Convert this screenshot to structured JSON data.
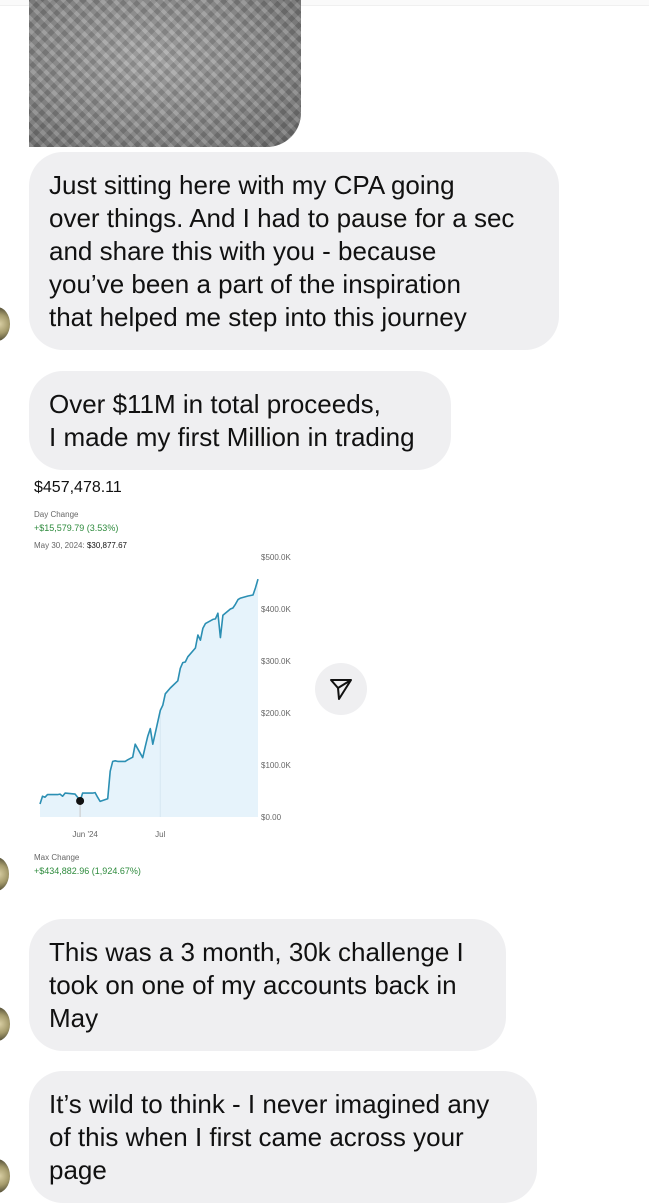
{
  "messages": [
    {
      "lines": [
        "Just sitting here with my CPA going",
        "over things. And I had to pause for a sec",
        "and share this with you - because",
        "you’ve been a part of the inspiration",
        "that helped me step into this journey"
      ]
    },
    {
      "lines": [
        "Over $11M in total proceeds,",
        "I made my first Million in trading"
      ]
    },
    {
      "lines": [
        "This was a 3 month, 30k challenge I",
        "took on one of my accounts back in",
        "May"
      ]
    },
    {
      "lines": [
        "It’s wild to think - I never imagined any",
        "of this when I first came across your",
        "page"
      ]
    }
  ],
  "portfolio": {
    "balance": "$457,478.11",
    "day_change_label": "Day Change",
    "day_change_value": "+$15,579.79 (3.53%)",
    "selected_date": "May 30, 2024:",
    "selected_value": "$30,877.67",
    "max_change_label": "Max Change",
    "max_change_value": "+$434,882.96 (1,924.67%)"
  },
  "chart_data": {
    "type": "area",
    "title": "",
    "xlabel": "",
    "ylabel": "",
    "x_tick_labels": [
      "Jun '24",
      "Jul"
    ],
    "y_tick_labels": [
      "$500.0K",
      "$400.0K",
      "$300.0K",
      "$200.0K",
      "$100.0K",
      "$0.00"
    ],
    "ylim": [
      0,
      500000
    ],
    "y_axis_position": "right",
    "grid": false,
    "line_color": "#2b8fb3",
    "fill_color": "#e6f3fb",
    "marker": {
      "date": "2024-05-30",
      "value": 30877.67,
      "color": "#111111"
    },
    "series": [
      {
        "x": [
          "2024-05-14",
          "2024-05-15",
          "2024-05-16",
          "2024-05-17",
          "2024-05-20",
          "2024-05-21",
          "2024-05-22",
          "2024-05-23",
          "2024-05-24",
          "2024-05-28",
          "2024-05-29",
          "2024-05-30",
          "2024-05-31",
          "2024-06-03",
          "2024-06-04",
          "2024-06-05",
          "2024-06-06",
          "2024-06-07",
          "2024-06-10",
          "2024-06-11",
          "2024-06-12",
          "2024-06-13",
          "2024-06-14",
          "2024-06-17",
          "2024-06-18",
          "2024-06-20",
          "2024-06-21",
          "2024-06-24",
          "2024-06-25",
          "2024-06-26",
          "2024-06-27",
          "2024-06-28",
          "2024-07-01",
          "2024-07-02",
          "2024-07-03",
          "2024-07-05",
          "2024-07-08",
          "2024-07-09",
          "2024-07-10",
          "2024-07-11",
          "2024-07-12",
          "2024-07-15",
          "2024-07-16",
          "2024-07-17",
          "2024-07-18",
          "2024-07-19",
          "2024-07-22",
          "2024-07-23",
          "2024-07-24",
          "2024-07-25",
          "2024-07-26",
          "2024-07-29",
          "2024-07-30",
          "2024-07-31",
          "2024-08-01",
          "2024-08-02",
          "2024-08-05",
          "2024-08-06",
          "2024-08-07",
          "2024-08-08",
          "2024-08-09"
        ],
        "values": [
          25000,
          40000,
          38000,
          43000,
          43000,
          43000,
          44000,
          40000,
          46000,
          44000,
          38000,
          30878,
          46000,
          46000,
          46000,
          47000,
          38000,
          30000,
          35000,
          88000,
          107000,
          108000,
          107000,
          107000,
          110000,
          115000,
          140000,
          114000,
          135000,
          155000,
          170000,
          140000,
          205000,
          215000,
          237000,
          248000,
          262000,
          286000,
          297000,
          298000,
          308000,
          325000,
          350000,
          340000,
          363000,
          372000,
          380000,
          381000,
          392000,
          345000,
          388000,
          400000,
          402000,
          409000,
          418000,
          421000,
          425000,
          426000,
          427000,
          441000,
          457478
        ]
      }
    ]
  }
}
